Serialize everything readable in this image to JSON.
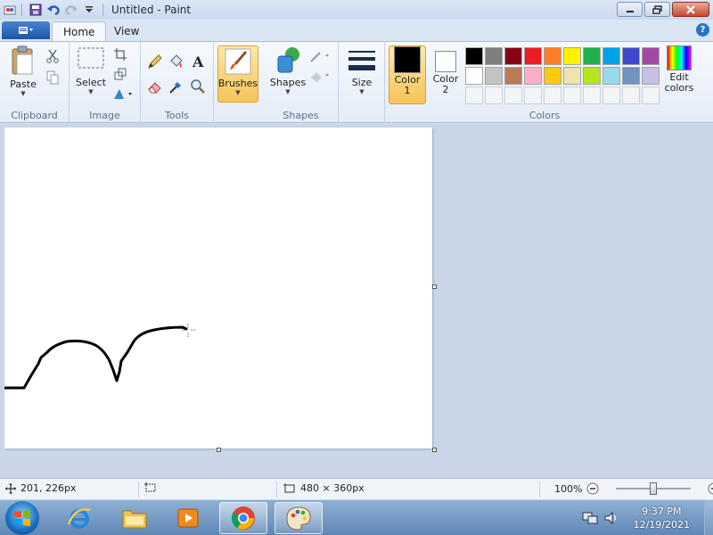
{
  "window": {
    "title": "Untitled - Paint"
  },
  "quick_access": {
    "save": "save-icon",
    "undo": "undo-icon",
    "redo": "redo-icon",
    "customize": "dropdown-icon"
  },
  "tabs": {
    "file_icon": "menu-icon",
    "home": "Home",
    "view": "View"
  },
  "ribbon": {
    "clipboard": {
      "group": "Clipboard",
      "paste": "Paste"
    },
    "image": {
      "group": "Image",
      "select": "Select"
    },
    "tools": {
      "group": "Tools"
    },
    "brushes": {
      "label": "Brushes"
    },
    "shapes": {
      "group": "Shapes",
      "label": "Shapes"
    },
    "size": {
      "label": "Size"
    },
    "colors": {
      "group": "Colors",
      "color1_line1": "Color",
      "color1_line2": "1",
      "color2_line1": "Color",
      "color2_line2": "2",
      "edit_line1": "Edit",
      "edit_line2": "colors",
      "color1_value": "#000000",
      "color2_value": "#ffffff",
      "palette_row1": [
        "#000000",
        "#7f7f7f",
        "#880015",
        "#ed1c24",
        "#ff7f27",
        "#fff200",
        "#22b14c",
        "#00a2e8",
        "#3f48cc",
        "#a349a4"
      ],
      "palette_row2": [
        "#ffffff",
        "#c3c3c3",
        "#b97a57",
        "#ffaec9",
        "#ffc90e",
        "#efe4b0",
        "#b5e61d",
        "#99d9ea",
        "#7092be",
        "#c8bfe7"
      ],
      "palette_row3": [
        "",
        "",
        "",
        "",
        "",
        "",
        "",
        "",
        "",
        ""
      ]
    }
  },
  "status": {
    "cursor_pos": "201, 226px",
    "canvas_size": "480 × 360px",
    "zoom": "100%"
  },
  "taskbar": {
    "apps": [
      "internet-explorer",
      "file-explorer",
      "media-player",
      "chrome",
      "paint"
    ],
    "time": "9:37 PM",
    "date": "12/19/2021"
  }
}
